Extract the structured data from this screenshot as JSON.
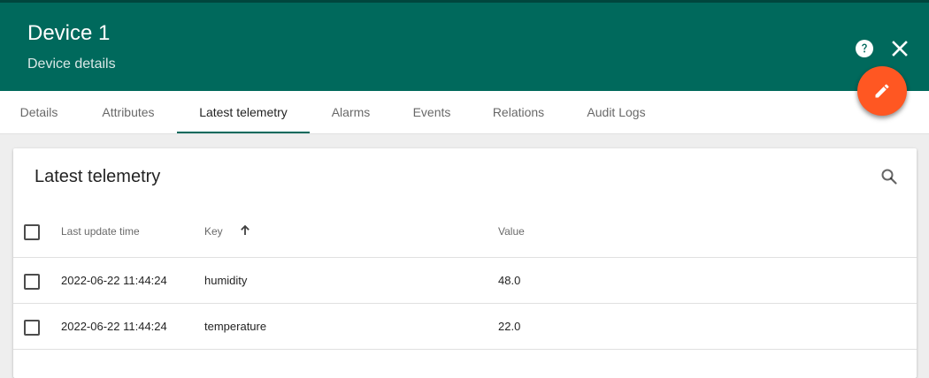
{
  "header": {
    "title": "Device 1",
    "subtitle": "Device details"
  },
  "icons": {
    "help": "help-circle-icon",
    "close": "close-icon",
    "edit": "pencil-icon",
    "search": "search-icon",
    "sort": "arrow-upward-icon"
  },
  "colors": {
    "primary": "#00695c",
    "accent": "#ff5722"
  },
  "tabs": [
    {
      "label": "Details",
      "active": false
    },
    {
      "label": "Attributes",
      "active": false
    },
    {
      "label": "Latest telemetry",
      "active": true
    },
    {
      "label": "Alarms",
      "active": false
    },
    {
      "label": "Events",
      "active": false
    },
    {
      "label": "Relations",
      "active": false
    },
    {
      "label": "Audit Logs",
      "active": false
    }
  ],
  "panel": {
    "title": "Latest telemetry",
    "columns": {
      "last_update_time": "Last update time",
      "key": "Key",
      "value": "Value"
    },
    "sort": {
      "column": "key",
      "direction": "asc"
    },
    "rows": [
      {
        "last_update_time": "2022-06-22 11:44:24",
        "key": "humidity",
        "value": "48.0"
      },
      {
        "last_update_time": "2022-06-22 11:44:24",
        "key": "temperature",
        "value": "22.0"
      }
    ]
  }
}
